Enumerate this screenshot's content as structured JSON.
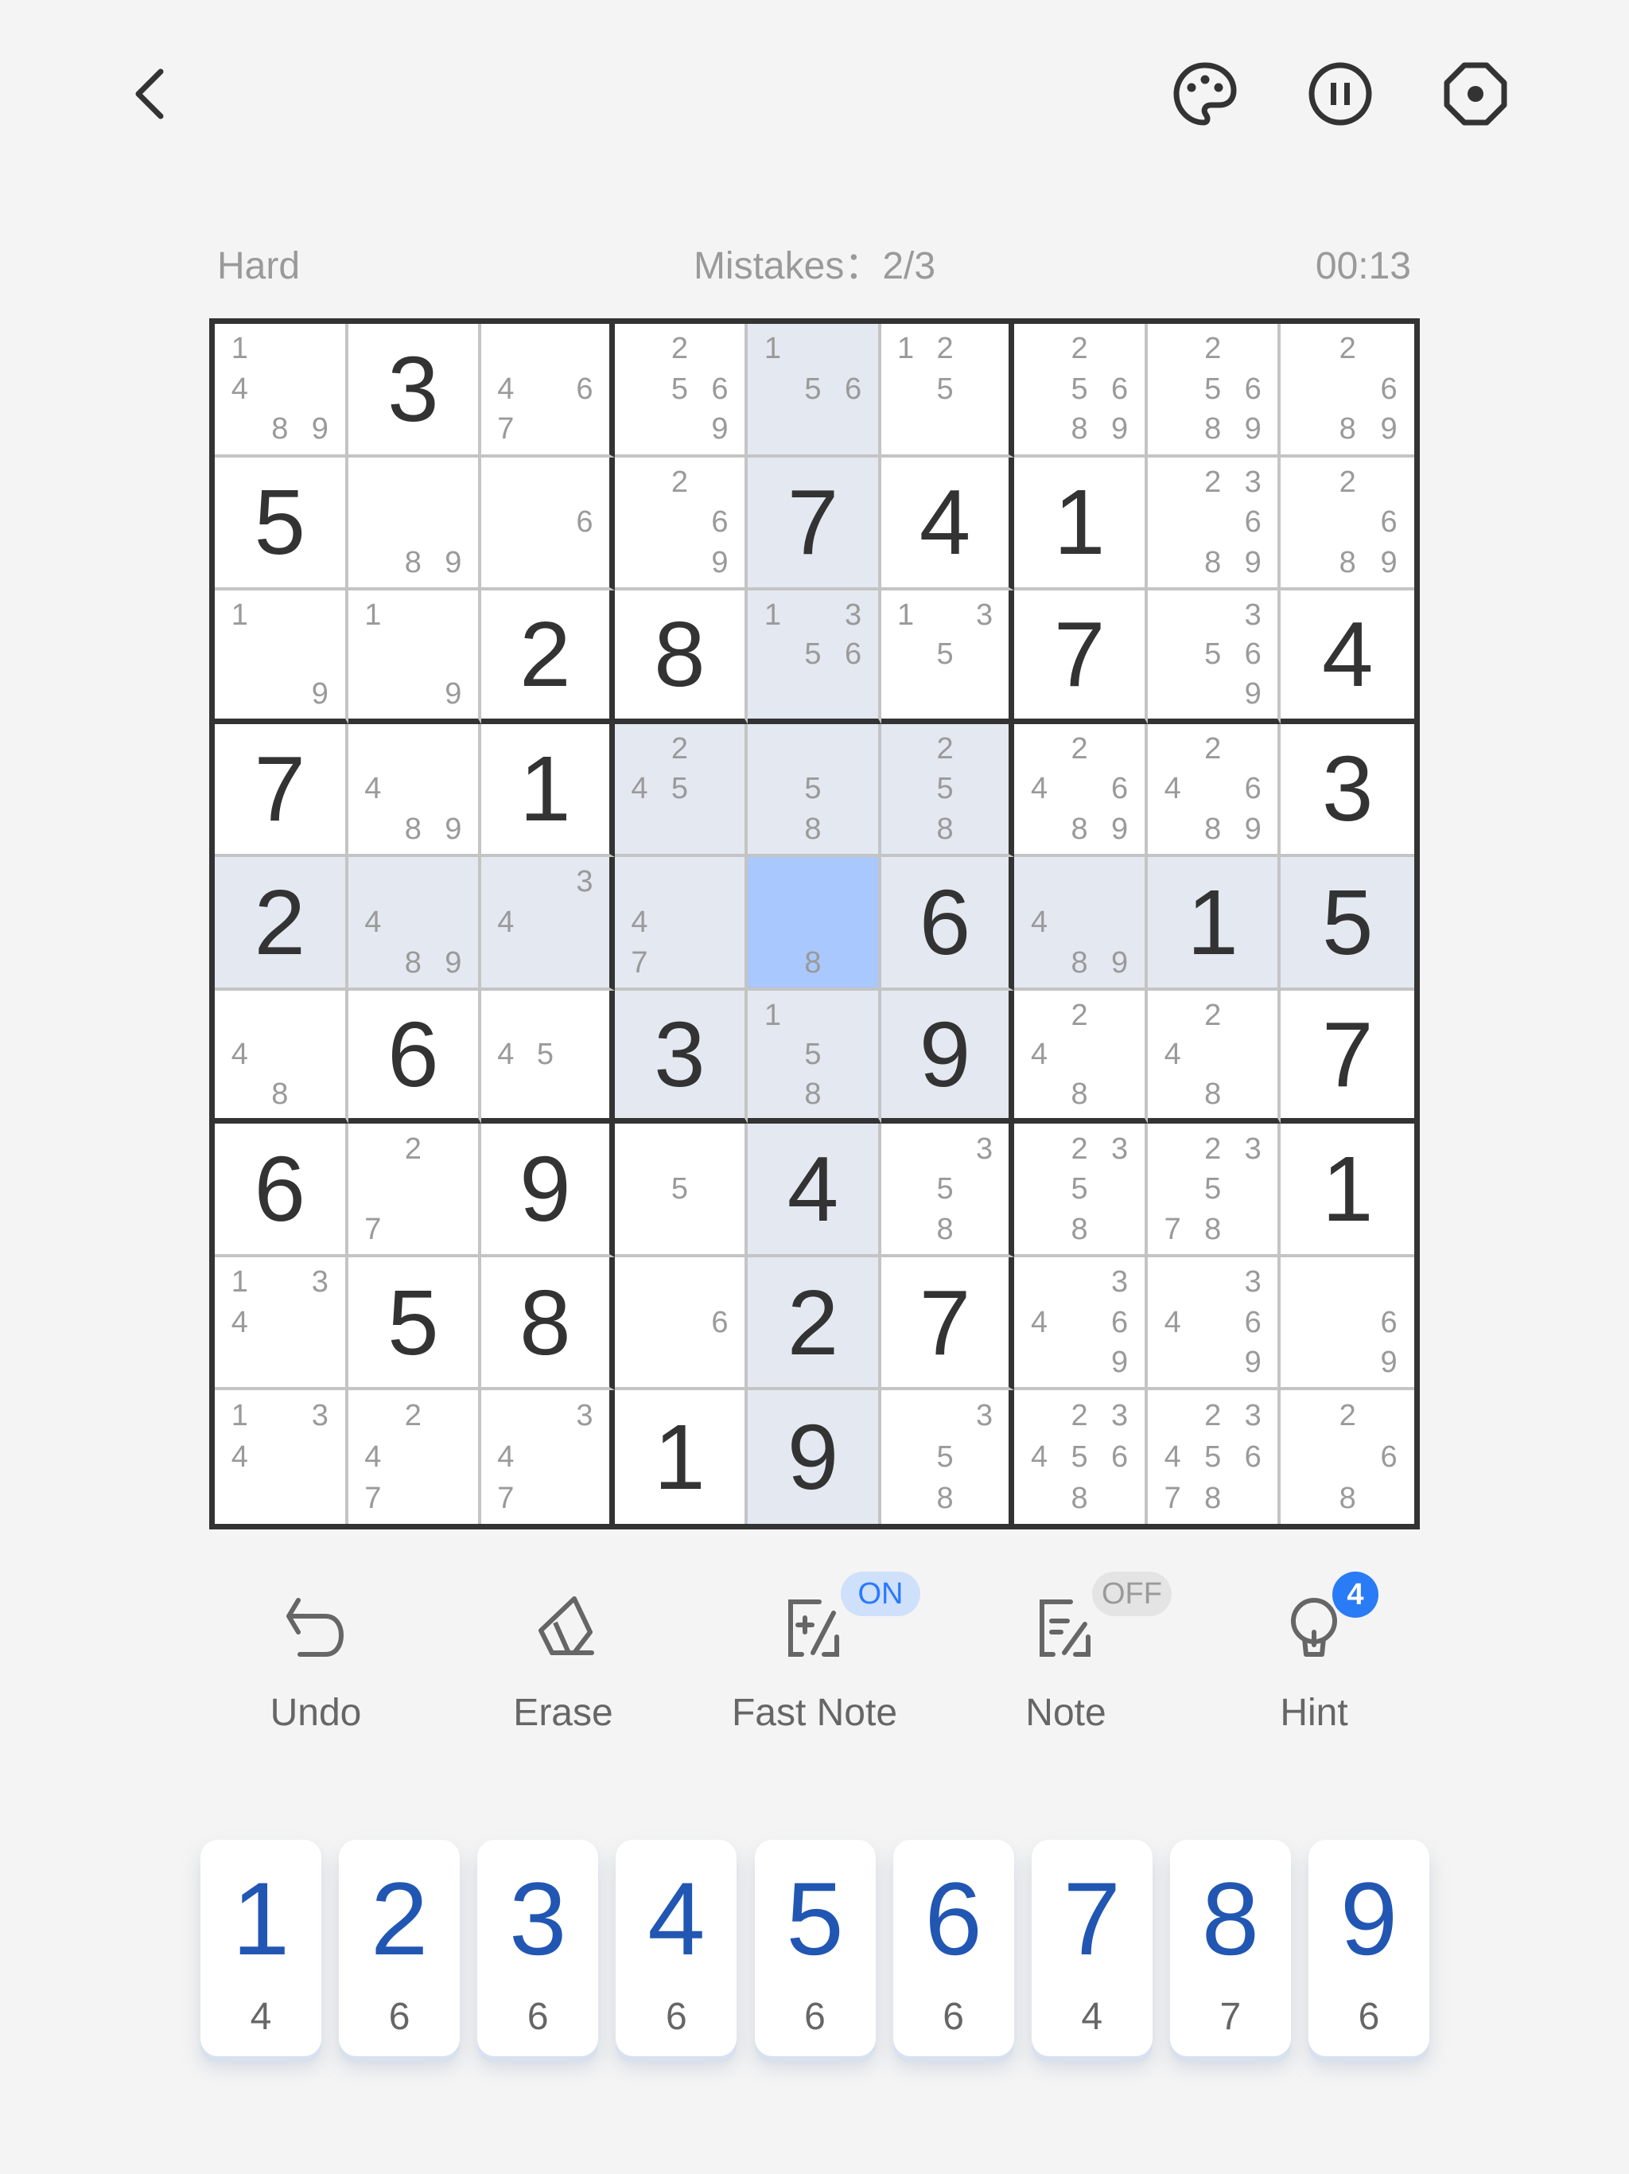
{
  "header": {
    "back_icon": "chevron-left-icon",
    "actions": [
      {
        "name": "theme",
        "icon": "palette-icon"
      },
      {
        "name": "pause",
        "icon": "pause-circle-icon"
      },
      {
        "name": "settings",
        "icon": "settings-octagon-icon"
      }
    ]
  },
  "status": {
    "difficulty": "Hard",
    "mistakes": "Mistakes：2/3",
    "timer": "00:13"
  },
  "board": {
    "selected": [
      4,
      4
    ],
    "highlighted_row": 4,
    "highlighted_col": 4,
    "highlighted_box": [
      1,
      1
    ],
    "cells": [
      [
        {
          "n": [
            1,
            4,
            8,
            9
          ]
        },
        {
          "v": 3
        },
        {
          "n": [
            4,
            6,
            7
          ]
        },
        {
          "n": [
            2,
            5,
            6,
            9
          ]
        },
        {
          "n": [
            1,
            5,
            6
          ]
        },
        {
          "n": [
            1,
            2,
            5
          ]
        },
        {
          "n": [
            2,
            5,
            6,
            8,
            9
          ]
        },
        {
          "n": [
            2,
            5,
            6,
            8,
            9
          ]
        },
        {
          "n": [
            2,
            6,
            8,
            9
          ]
        }
      ],
      [
        {
          "v": 5
        },
        {
          "n": [
            8,
            9
          ]
        },
        {
          "n": [
            6
          ]
        },
        {
          "n": [
            2,
            6,
            9
          ]
        },
        {
          "v": 7
        },
        {
          "v": 4
        },
        {
          "v": 1
        },
        {
          "n": [
            2,
            3,
            6,
            8,
            9
          ]
        },
        {
          "n": [
            2,
            6,
            8,
            9
          ]
        }
      ],
      [
        {
          "n": [
            1,
            9
          ]
        },
        {
          "n": [
            1,
            9
          ]
        },
        {
          "v": 2
        },
        {
          "v": 8
        },
        {
          "n": [
            1,
            3,
            5,
            6
          ]
        },
        {
          "n": [
            1,
            3,
            5
          ]
        },
        {
          "v": 7
        },
        {
          "n": [
            3,
            5,
            6,
            9
          ]
        },
        {
          "v": 4
        }
      ],
      [
        {
          "v": 7
        },
        {
          "n": [
            4,
            8,
            9
          ]
        },
        {
          "v": 1
        },
        {
          "n": [
            2,
            4,
            5
          ]
        },
        {
          "n": [
            5,
            8
          ]
        },
        {
          "n": [
            2,
            5,
            8
          ]
        },
        {
          "n": [
            2,
            4,
            6,
            8,
            9
          ]
        },
        {
          "n": [
            2,
            4,
            6,
            8,
            9
          ]
        },
        {
          "v": 3
        }
      ],
      [
        {
          "v": 2
        },
        {
          "n": [
            4,
            8,
            9
          ]
        },
        {
          "n": [
            3,
            4
          ]
        },
        {
          "n": [
            4,
            7
          ]
        },
        {
          "n": [
            8
          ]
        },
        {
          "v": 6
        },
        {
          "n": [
            4,
            8,
            9
          ]
        },
        {
          "v": 1
        },
        {
          "v": 5
        }
      ],
      [
        {
          "n": [
            4,
            8
          ]
        },
        {
          "v": 6
        },
        {
          "n": [
            4,
            5
          ]
        },
        {
          "v": 3
        },
        {
          "n": [
            1,
            5,
            8
          ]
        },
        {
          "v": 9
        },
        {
          "n": [
            2,
            4,
            8
          ]
        },
        {
          "n": [
            2,
            4,
            8
          ]
        },
        {
          "v": 7
        }
      ],
      [
        {
          "v": 6
        },
        {
          "n": [
            2,
            7
          ]
        },
        {
          "v": 9
        },
        {
          "n": [
            5
          ]
        },
        {
          "v": 4
        },
        {
          "n": [
            3,
            5,
            8
          ]
        },
        {
          "n": [
            2,
            3,
            5,
            8
          ]
        },
        {
          "n": [
            2,
            3,
            5,
            7,
            8
          ]
        },
        {
          "v": 1
        }
      ],
      [
        {
          "n": [
            1,
            3,
            4
          ]
        },
        {
          "v": 5
        },
        {
          "v": 8
        },
        {
          "n": [
            6
          ]
        },
        {
          "v": 2
        },
        {
          "v": 7
        },
        {
          "n": [
            3,
            4,
            6,
            9
          ]
        },
        {
          "n": [
            3,
            4,
            6,
            9
          ]
        },
        {
          "n": [
            6,
            9
          ]
        }
      ],
      [
        {
          "n": [
            1,
            3,
            4
          ]
        },
        {
          "n": [
            2,
            4,
            7
          ]
        },
        {
          "n": [
            3,
            4,
            7
          ]
        },
        {
          "v": 1
        },
        {
          "v": 9
        },
        {
          "n": [
            3,
            5,
            8
          ]
        },
        {
          "n": [
            2,
            3,
            4,
            5,
            6,
            8
          ]
        },
        {
          "n": [
            2,
            3,
            4,
            5,
            6,
            7,
            8
          ]
        },
        {
          "n": [
            2,
            6,
            8
          ]
        }
      ]
    ]
  },
  "toolbar": {
    "undo": {
      "label": "Undo",
      "icon": "undo-icon"
    },
    "erase": {
      "label": "Erase",
      "icon": "eraser-icon"
    },
    "fast_note": {
      "label": "Fast Note",
      "icon": "fast-note-icon",
      "state": "ON"
    },
    "note": {
      "label": "Note",
      "icon": "note-pencil-icon",
      "state": "OFF"
    },
    "hint": {
      "label": "Hint",
      "icon": "lightbulb-icon",
      "count": "4"
    }
  },
  "numpad": [
    {
      "digit": "1",
      "remaining": "4"
    },
    {
      "digit": "2",
      "remaining": "6"
    },
    {
      "digit": "3",
      "remaining": "6"
    },
    {
      "digit": "4",
      "remaining": "6"
    },
    {
      "digit": "5",
      "remaining": "6"
    },
    {
      "digit": "6",
      "remaining": "6"
    },
    {
      "digit": "7",
      "remaining": "4"
    },
    {
      "digit": "8",
      "remaining": "7"
    },
    {
      "digit": "9",
      "remaining": "6"
    }
  ],
  "colors": {
    "selected_cell": "#a9c8fd",
    "highlight": "#e3e8f1",
    "digit_blue": "#2156b3",
    "badge_blue": "#2a7bf6"
  }
}
